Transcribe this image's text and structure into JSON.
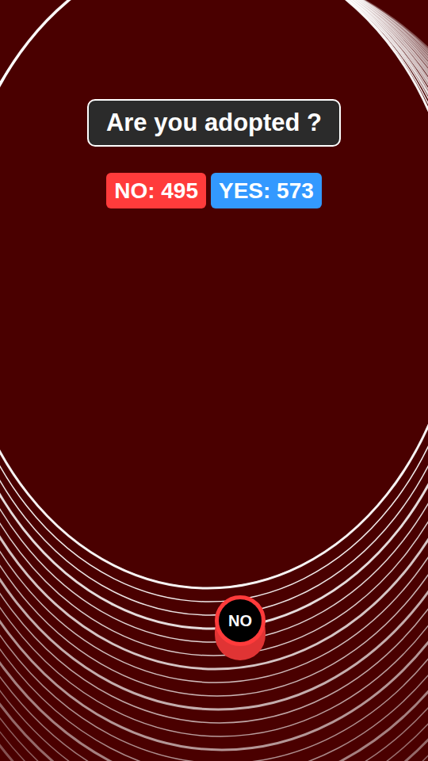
{
  "question": "Are you adopted ?",
  "scores": [
    {
      "label": "NO: 495",
      "color": "#ff3b3b"
    },
    {
      "label": "YES: 573",
      "color": "#3399ff"
    }
  ],
  "player": {
    "label": "NO",
    "color": "#ff3b3b"
  }
}
